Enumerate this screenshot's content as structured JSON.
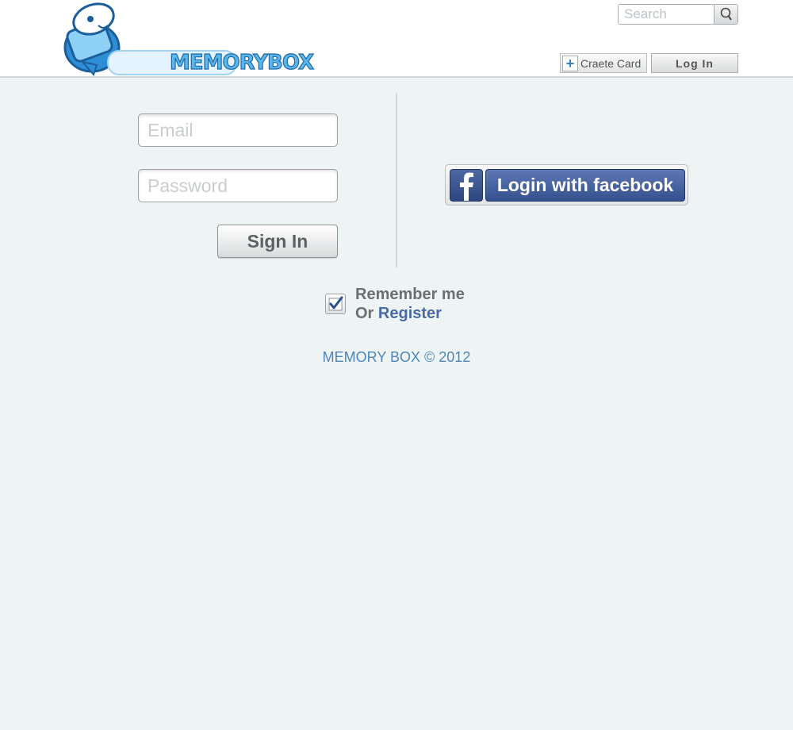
{
  "header": {
    "logo_text": "MEMORYBOX",
    "search": {
      "placeholder": "Search"
    },
    "create_card_label": "Craete Card",
    "login_label": "Log In"
  },
  "login_form": {
    "email_placeholder": "Email",
    "password_placeholder": "Password",
    "sign_in_label": "Sign In",
    "facebook_label": "Login with facebook",
    "remember_label": "Remember me",
    "remember_checked": true,
    "or_text": "Or",
    "register_label": "Register"
  },
  "footer": {
    "copyright": "MEMORY BOX © 2012"
  },
  "colors": {
    "accent_blue": "#4f86b6",
    "facebook_blue": "#3b5998",
    "link_blue": "#4a6aa6"
  }
}
